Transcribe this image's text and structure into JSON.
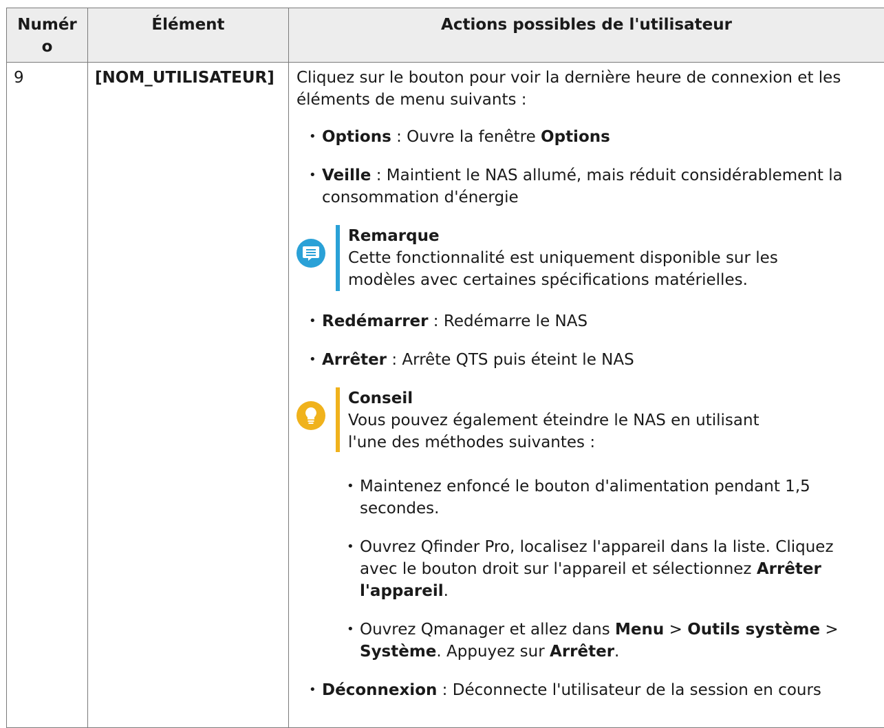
{
  "table": {
    "headers": [
      "Numér o",
      "Élément",
      "Actions possibles de l'utilisateur"
    ],
    "row": {
      "number": "9",
      "element": "[NOM_UTILISATEUR]",
      "intro": "Cliquez sur le bouton pour voir la dernière heure de connexion et les éléments de menu suivants :",
      "items": {
        "options": {
          "term": "Options",
          "sep": " : ",
          "text": "Ouvre la fenêtre ",
          "text_bold": "Options"
        },
        "veille": {
          "term": "Veille",
          "sep": " : ",
          "text": "Maintient le NAS allumé, mais réduit considérablement la consommation d'énergie"
        },
        "redemarrer": {
          "term": "Redémarrer",
          "sep": " : ",
          "text": "Redémarre le NAS"
        },
        "arreter": {
          "term": "Arrêter",
          "sep": " : ",
          "text": "Arrête QTS puis éteint le NAS"
        },
        "deconnexion": {
          "term": "Déconnexion",
          "sep": " : ",
          "text": "Déconnecte l'utilisateur de la session en cours"
        }
      },
      "note": {
        "icon": "note-icon",
        "color": "#2aa1d7",
        "title": "Remarque",
        "text": "Cette fonctionnalité est uniquement disponible sur les modèles avec certaines spécifications matérielles."
      },
      "tip": {
        "icon": "lightbulb-icon",
        "color": "#f0b21c",
        "title": "Conseil",
        "text": "Vous pouvez également éteindre le NAS en utilisant l'une des méthodes suivantes :"
      },
      "methods": {
        "m1": "Maintenez enfoncé le bouton d'alimentation pendant 1,5 secondes.",
        "m2": {
          "text": "Ouvrez Qfinder Pro, localisez l'appareil dans la liste. Cliquez avec le bouton droit sur l'appareil et sélectionnez ",
          "bold": "Arrêter l'appareil",
          "end": "."
        },
        "m3": {
          "t1": "Ouvrez Qmanager et allez dans ",
          "b1": "Menu",
          "t2": " > ",
          "b2": "Outils système",
          "t3": " > ",
          "b3": "Système",
          "t4": ". Appuyez sur ",
          "b4": "Arrêter",
          "t5": "."
        }
      }
    }
  }
}
